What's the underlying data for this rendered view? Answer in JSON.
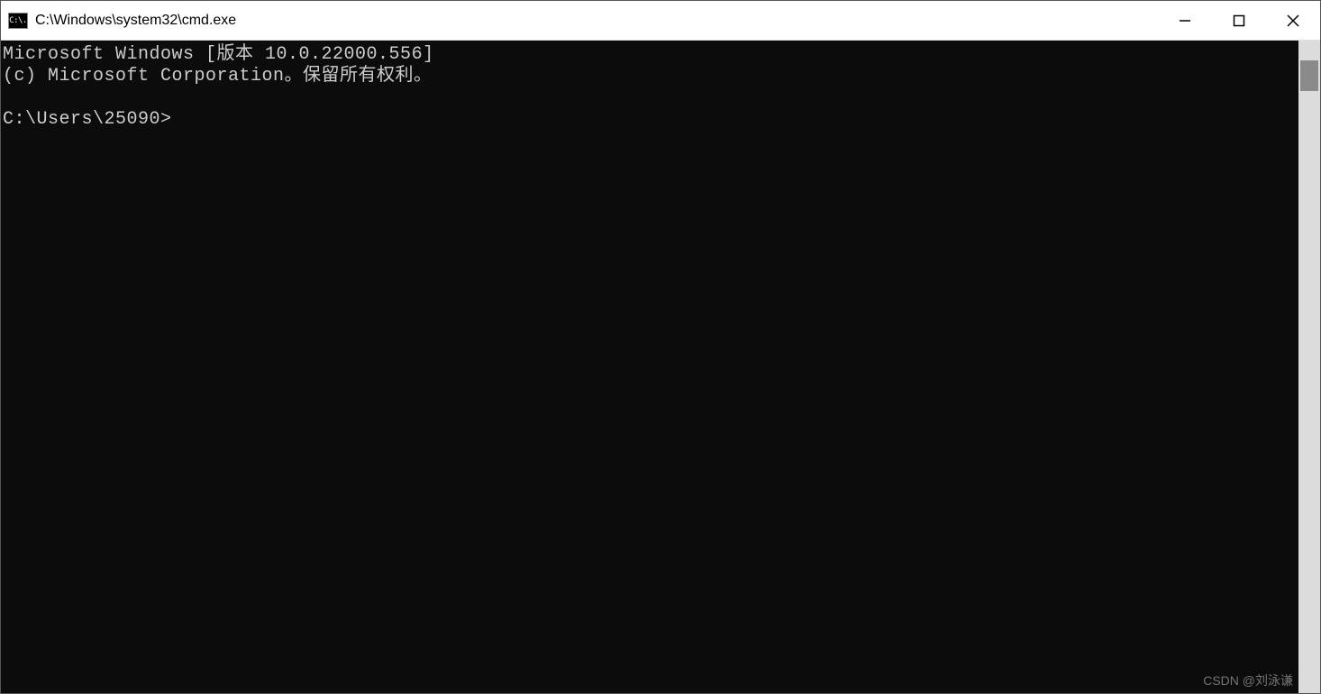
{
  "titlebar": {
    "icon_label": "C:\\.",
    "title": "C:\\Windows\\system32\\cmd.exe"
  },
  "terminal": {
    "line1": "Microsoft Windows [版本 10.0.22000.556]",
    "line2": "(c) Microsoft Corporation。保留所有权利。",
    "blank": "",
    "prompt": "C:\\Users\\25090>"
  },
  "watermark": "CSDN @刘泳谦"
}
